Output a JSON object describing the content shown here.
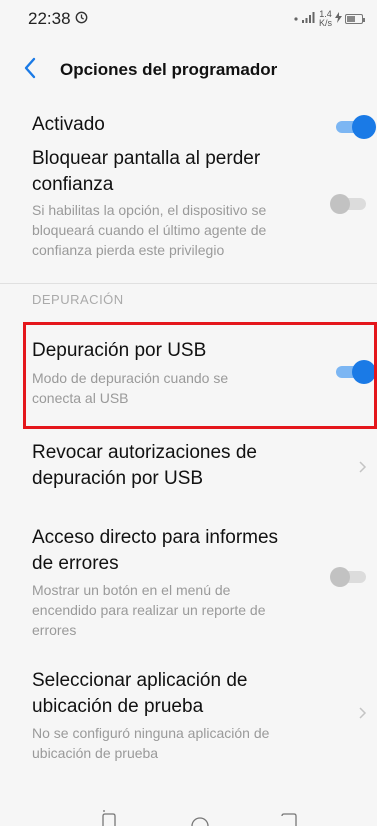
{
  "status_bar": {
    "time": "22:38",
    "net_speed_value": "1.4",
    "net_speed_unit": "K/s",
    "battery_level": 0.6
  },
  "header": {
    "title": "Opciones del programador"
  },
  "items": {
    "activado": {
      "title": "Activado",
      "toggle": "on"
    },
    "bloquear": {
      "title_line1": "Bloquear pantalla al perder",
      "title_line2": "confianza",
      "sub_line1": "Si habilitas la opción, el dispositivo se",
      "sub_line2": "bloqueará cuando el último agente de",
      "sub_line3": "confianza pierda este privilegio",
      "toggle": "off"
    },
    "section_label": "DEPURACIÓN",
    "usb_debug": {
      "title": "Depuración por USB",
      "sub_line1": "Modo de depuración cuando se",
      "sub_line2": "conecta al USB",
      "toggle": "on"
    },
    "revoke": {
      "title_line1": "Revocar autorizaciones de",
      "title_line2": "depuración por USB"
    },
    "bug_report": {
      "title_line1": "Acceso directo para informes",
      "title_line2": "de errores",
      "sub_line1": "Mostrar un botón en el menú de",
      "sub_line2": "encendido para realizar un reporte de",
      "sub_line3": "errores",
      "toggle": "off"
    },
    "mock_location": {
      "title_line1": "Seleccionar aplicación de",
      "title_line2": "ubicación de prueba",
      "sub_line1": "No se configuró ninguna aplicación de",
      "sub_line2": "ubicación de prueba"
    }
  },
  "colors": {
    "accent": "#1a7ae6",
    "highlight": "#e4161b",
    "secondary_text": "#9a9a9a"
  },
  "icons": {
    "back": "back-arrow-icon",
    "chevron": "chevron-right-icon",
    "alarm": "alarm-icon",
    "signal": "signal-icon",
    "battery": "battery-icon"
  }
}
